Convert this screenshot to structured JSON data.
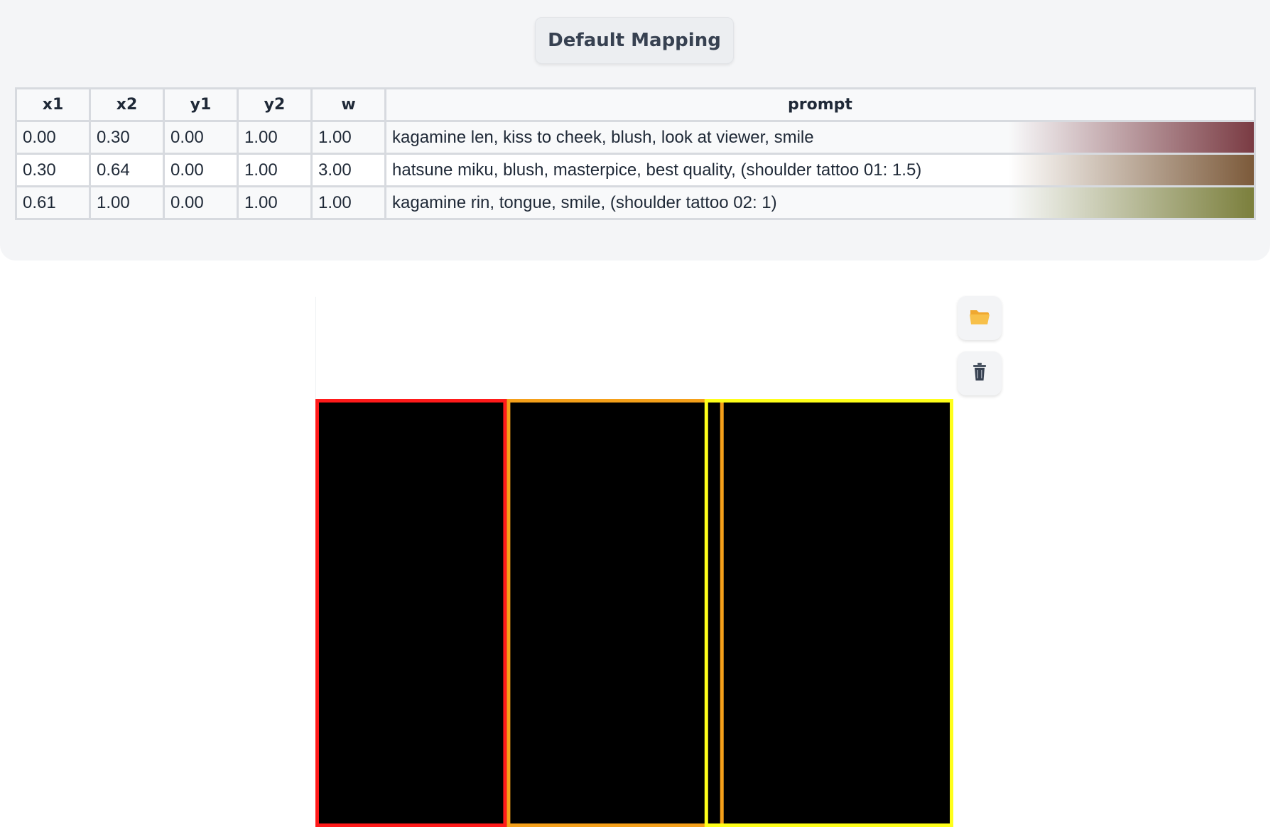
{
  "toolbar": {
    "default_mapping_label": "Default Mapping"
  },
  "table": {
    "headers": [
      "x1",
      "x2",
      "y1",
      "y2",
      "w",
      "prompt"
    ],
    "rows": [
      {
        "x1": "0.00",
        "x2": "0.30",
        "y1": "0.00",
        "y2": "1.00",
        "w": "1.00",
        "prompt": "kagamine len, kiss to cheek, blush, look at viewer, smile",
        "color": "#7a3b43"
      },
      {
        "x1": "0.30",
        "x2": "0.64",
        "y1": "0.00",
        "y2": "1.00",
        "w": "3.00",
        "prompt": "hatsune miku, blush, masterpice, best quality, (shoulder tattoo 01: 1.5)",
        "color": "#7c5a3a"
      },
      {
        "x1": "0.61",
        "x2": "1.00",
        "y1": "0.00",
        "y2": "1.00",
        "w": "1.00",
        "prompt": "kagamine rin, tongue, smile, (shoulder tattoo 02: 1)",
        "color": "#7b7f3c"
      }
    ]
  },
  "canvas": {
    "background": "#000000",
    "regions": [
      {
        "x1": 0.0,
        "x2": 0.3,
        "y1": 0.0,
        "y2": 1.0,
        "color": "#ff1a1a"
      },
      {
        "x1": 0.3,
        "x2": 0.64,
        "y1": 0.0,
        "y2": 1.0,
        "color": "#f5a01a"
      },
      {
        "x1": 0.61,
        "x2": 1.0,
        "y1": 0.0,
        "y2": 1.0,
        "color": "#ffff1a"
      }
    ]
  },
  "tools": {
    "open_icon": "folder-icon",
    "delete_icon": "trash-icon"
  }
}
